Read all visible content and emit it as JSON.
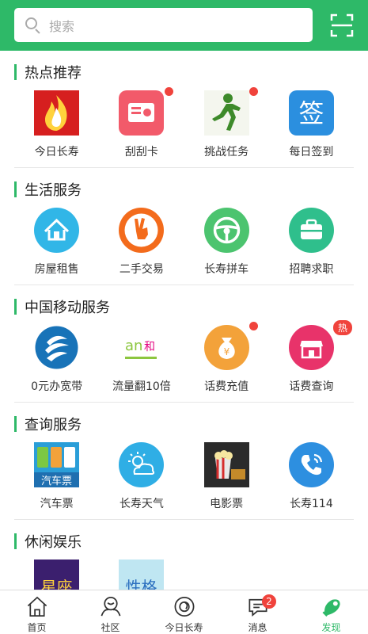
{
  "search": {
    "placeholder": "搜索"
  },
  "sections": [
    {
      "title": "热点推荐",
      "items": [
        {
          "label": "今日长寿",
          "icon": "flame-logo-icon"
        },
        {
          "label": "刮刮卡",
          "icon": "scratch-card-icon"
        },
        {
          "label": "挑战任务",
          "icon": "runner-icon"
        },
        {
          "label": "每日签到",
          "icon": "checkin-sign-icon"
        }
      ]
    },
    {
      "title": "生活服务",
      "items": [
        {
          "label": "房屋租售",
          "icon": "house-icon"
        },
        {
          "label": "二手交易",
          "icon": "second-hand-icon"
        },
        {
          "label": "长寿拼车",
          "icon": "steering-wheel-icon"
        },
        {
          "label": "招聘求职",
          "icon": "briefcase-icon"
        }
      ]
    },
    {
      "title": "中国移动服务",
      "items": [
        {
          "label": "0元办宽带",
          "icon": "china-mobile-icon"
        },
        {
          "label": "流量翻10倍",
          "icon": "and-logo-icon"
        },
        {
          "label": "话费充值",
          "icon": "money-bag-icon"
        },
        {
          "label": "话费查询",
          "icon": "shop-icon"
        }
      ]
    },
    {
      "title": "查询服务",
      "items": [
        {
          "label": "汽车票",
          "icon": "bus-ticket-icon",
          "icon_text": "汽车票"
        },
        {
          "label": "长寿天气",
          "icon": "weather-icon"
        },
        {
          "label": "电影票",
          "icon": "cinema-icon"
        },
        {
          "label": "长寿114",
          "icon": "phone-icon"
        }
      ]
    },
    {
      "title": "休闲娱乐",
      "items": [
        {
          "label": "",
          "icon": "constellation-icon",
          "icon_text": "星座"
        },
        {
          "label": "",
          "icon": "personality-icon",
          "icon_text": "性格"
        }
      ]
    }
  ],
  "badges": {
    "hot": "热",
    "messages": "2"
  },
  "tabs": [
    {
      "label": "首页",
      "icon": "home-icon"
    },
    {
      "label": "社区",
      "icon": "community-icon"
    },
    {
      "label": "今日长寿",
      "icon": "news-icon"
    },
    {
      "label": "消息",
      "icon": "message-icon"
    },
    {
      "label": "发现",
      "icon": "discover-icon",
      "active": true
    }
  ],
  "colors": {
    "brand": "#2eb968",
    "alert": "#f0433c"
  }
}
